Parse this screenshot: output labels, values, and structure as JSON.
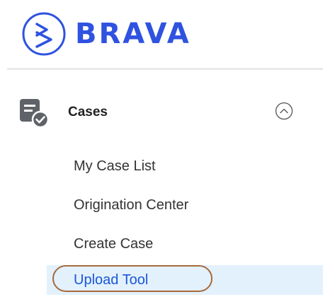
{
  "brand": {
    "name": "BRAVA",
    "color": "#2f52e0",
    "logo_icon": "brava-logo-icon"
  },
  "section": {
    "title": "Cases",
    "icon": "cases-icon",
    "toggle_icon": "chevron-up-circle-icon",
    "expanded": true
  },
  "menu": {
    "items": [
      {
        "label": "My Case List"
      },
      {
        "label": "Origination Center"
      },
      {
        "label": "Create Case"
      },
      {
        "label": "Upload Tool"
      }
    ],
    "active_index": 3,
    "active_bg": "#e3f1fd",
    "highlight_ring_color": "#a86a3a"
  }
}
